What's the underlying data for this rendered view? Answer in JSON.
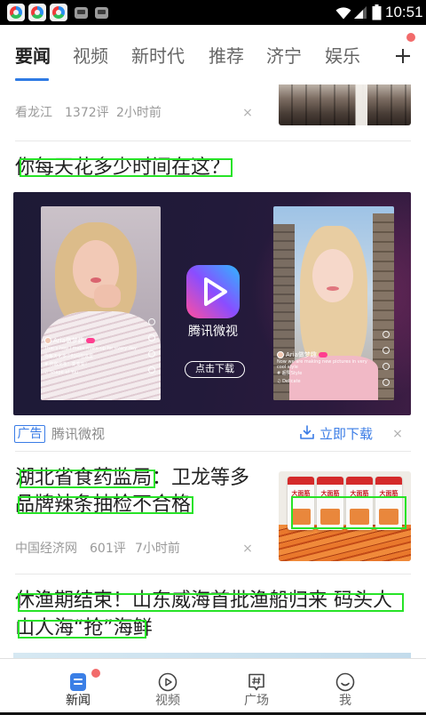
{
  "status_bar": {
    "time": "10:51",
    "notification_icons": [
      "app-notification-icon",
      "app-notification-icon",
      "app-notification-icon",
      "message-icon",
      "message-icon"
    ],
    "system_icons": [
      "wifi-icon",
      "signal-icon",
      "battery-icon"
    ]
  },
  "channel_tabs": {
    "items": [
      {
        "label": "要闻",
        "selected": true
      },
      {
        "label": "视频",
        "selected": false
      },
      {
        "label": "新时代",
        "selected": false
      },
      {
        "label": "推荐",
        "selected": false
      },
      {
        "label": "济宁",
        "selected": false
      },
      {
        "label": "娱乐",
        "selected": false
      }
    ],
    "add_icon": "plus-icon",
    "add_has_badge": true
  },
  "feed": {
    "partial_item": {
      "source": "看龙江",
      "comments": "1372评",
      "time": "2小时前",
      "dismiss": "×"
    },
    "photo_item": {
      "title": "你每天花多少时间在这？"
    },
    "ad": {
      "creative": {
        "app_name": "腾讯微视",
        "button_label": "点击下载",
        "logo_icon": "weishi-play-icon",
        "left_video": {
          "user": "Aria做梦趣",
          "caption": "That's how I make make-up for every day",
          "caption_cn": "你每天化多少时间在这里",
          "topic": "# 伤敌化妆！变变变！",
          "music": "♫ Shape of You"
        },
        "right_video": {
          "user": "Aria做梦趣",
          "caption": "Now we are making new pictures in very cool style",
          "topic": "# 超赞Style",
          "music": "♫ Delicate"
        }
      },
      "tag": "广告",
      "advertiser": "腾讯微视",
      "download_icon": "download-icon",
      "download_label": "立即下载",
      "dismiss": "×"
    },
    "news_item_1": {
      "title_lines": [
        "湖北省食药监局：卫龙等多",
        "品牌辣条抽检不合格"
      ],
      "thumbnail_labels": [
        "大面筋",
        "大面筋",
        "大面筋",
        "大面筋"
      ],
      "source": "中国经济网",
      "comments": "601评",
      "time": "7小时前",
      "dismiss": "×"
    },
    "news_item_2": {
      "title_lines": [
        "休渔期结束！山东威海首批渔船归来 码头人",
        "山人海“抢”海鲜"
      ]
    }
  },
  "bottom_nav": {
    "items": [
      {
        "label": "新闻",
        "icon": "news-icon",
        "selected": true,
        "has_badge": true
      },
      {
        "label": "视频",
        "icon": "video-play-icon",
        "selected": false
      },
      {
        "label": "广场",
        "icon": "square-hashtag-icon",
        "selected": false
      },
      {
        "label": "我",
        "icon": "profile-smile-icon",
        "selected": false
      }
    ]
  },
  "colors": {
    "accent_blue": "#3a7ce6",
    "badge_red": "#f26b6b",
    "text_primary": "#222222",
    "text_secondary": "#999999",
    "highlight_box_green": "#27e327",
    "status_bar": "#000000"
  }
}
